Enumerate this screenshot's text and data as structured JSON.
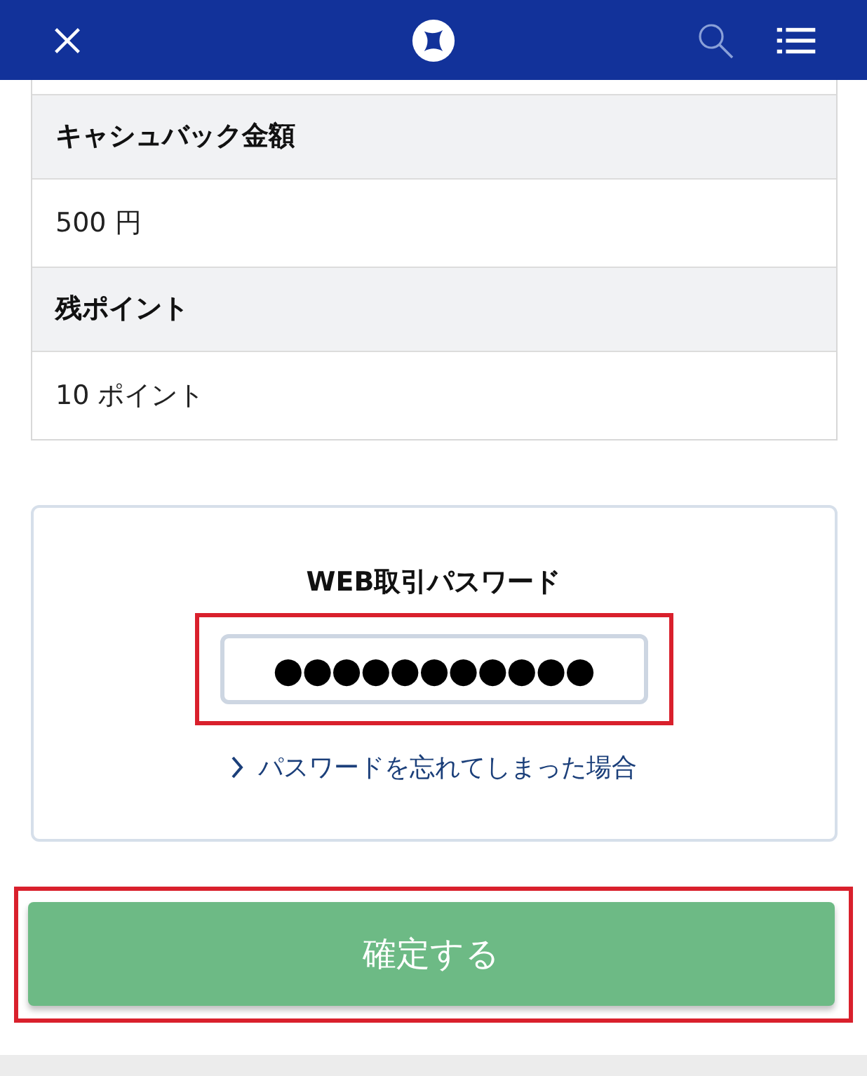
{
  "details": [
    {
      "label": "キャシュバック金額",
      "value": "500 円"
    },
    {
      "label": "残ポイント",
      "value": "10 ポイント"
    }
  ],
  "password": {
    "label": "WEB取引パスワード",
    "value": "●●●●●●●●●●●",
    "highlighted": true,
    "forgot_link": "パスワードを忘れてしまった場合"
  },
  "submit": {
    "label": "確定する",
    "highlighted": true
  }
}
